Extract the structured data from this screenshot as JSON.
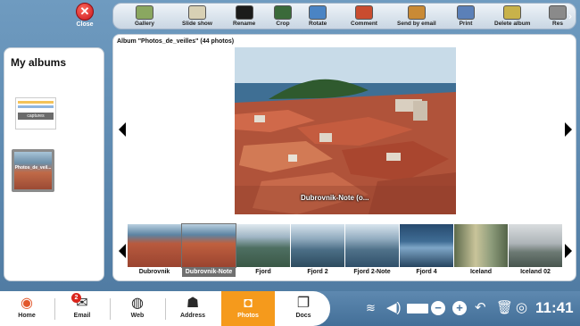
{
  "close": {
    "label": "Close",
    "icon": "close-icon"
  },
  "toolbar": {
    "items": [
      {
        "label": "Gallery",
        "icon": "gallery-icon",
        "color": "#8aa760"
      },
      {
        "label": "Slide show",
        "icon": "slideshow-icon",
        "color": "#d8d0b4"
      },
      {
        "label": "Rename",
        "icon": "rename-icon",
        "color": "#1b1b1b"
      },
      {
        "label": "Crop",
        "icon": "crop-icon",
        "color": "#3a6a3a"
      },
      {
        "label": "Rotate",
        "icon": "rotate-icon",
        "color": "#4a84c4"
      },
      {
        "label": "Comment",
        "icon": "comment-icon",
        "color": "#c94c2f"
      },
      {
        "label": "Send by email",
        "icon": "email-icon",
        "color": "#c98a35"
      },
      {
        "label": "Print",
        "icon": "print-icon",
        "color": "#5b80b8"
      },
      {
        "label": "Delete album",
        "icon": "delete-album-icon",
        "color": "#c8b24a"
      },
      {
        "label": "Res",
        "icon": "restore-icon",
        "color": "#8a8a8a"
      }
    ],
    "more_icon": "chevron-right-icon"
  },
  "sidebar": {
    "title": "My albums",
    "albums": [
      {
        "label": "captures"
      },
      {
        "label": "Photos_de_veil..."
      }
    ]
  },
  "album": {
    "title": "Album \"Photos_de_veilles\" (44 photos)",
    "current_caption": "Dubrovnik-Note (o...",
    "thumbnails": [
      {
        "label": "Dubrovnik",
        "selected": false
      },
      {
        "label": "Dubrovnik-Note",
        "selected": true
      },
      {
        "label": "Fjord",
        "selected": false
      },
      {
        "label": "Fjord 2",
        "selected": false
      },
      {
        "label": "Fjord 2-Note",
        "selected": false
      },
      {
        "label": "Fjord 4",
        "selected": false
      },
      {
        "label": "Iceland",
        "selected": false
      },
      {
        "label": "Iceland 02",
        "selected": false
      }
    ]
  },
  "taskbar": {
    "items": [
      {
        "label": "Home",
        "icon": "home-icon"
      },
      {
        "label": "Email",
        "icon": "email-icon",
        "badge": "2"
      },
      {
        "label": "Web",
        "icon": "globe-icon"
      },
      {
        "label": "Address",
        "icon": "address-book-icon"
      },
      {
        "label": "Photos",
        "icon": "camera-icon",
        "active": true
      },
      {
        "label": "Docs",
        "icon": "documents-icon"
      }
    ],
    "clock": "11:41"
  },
  "colors": {
    "accent": "#f59a1c",
    "background": "#5a86ad"
  }
}
